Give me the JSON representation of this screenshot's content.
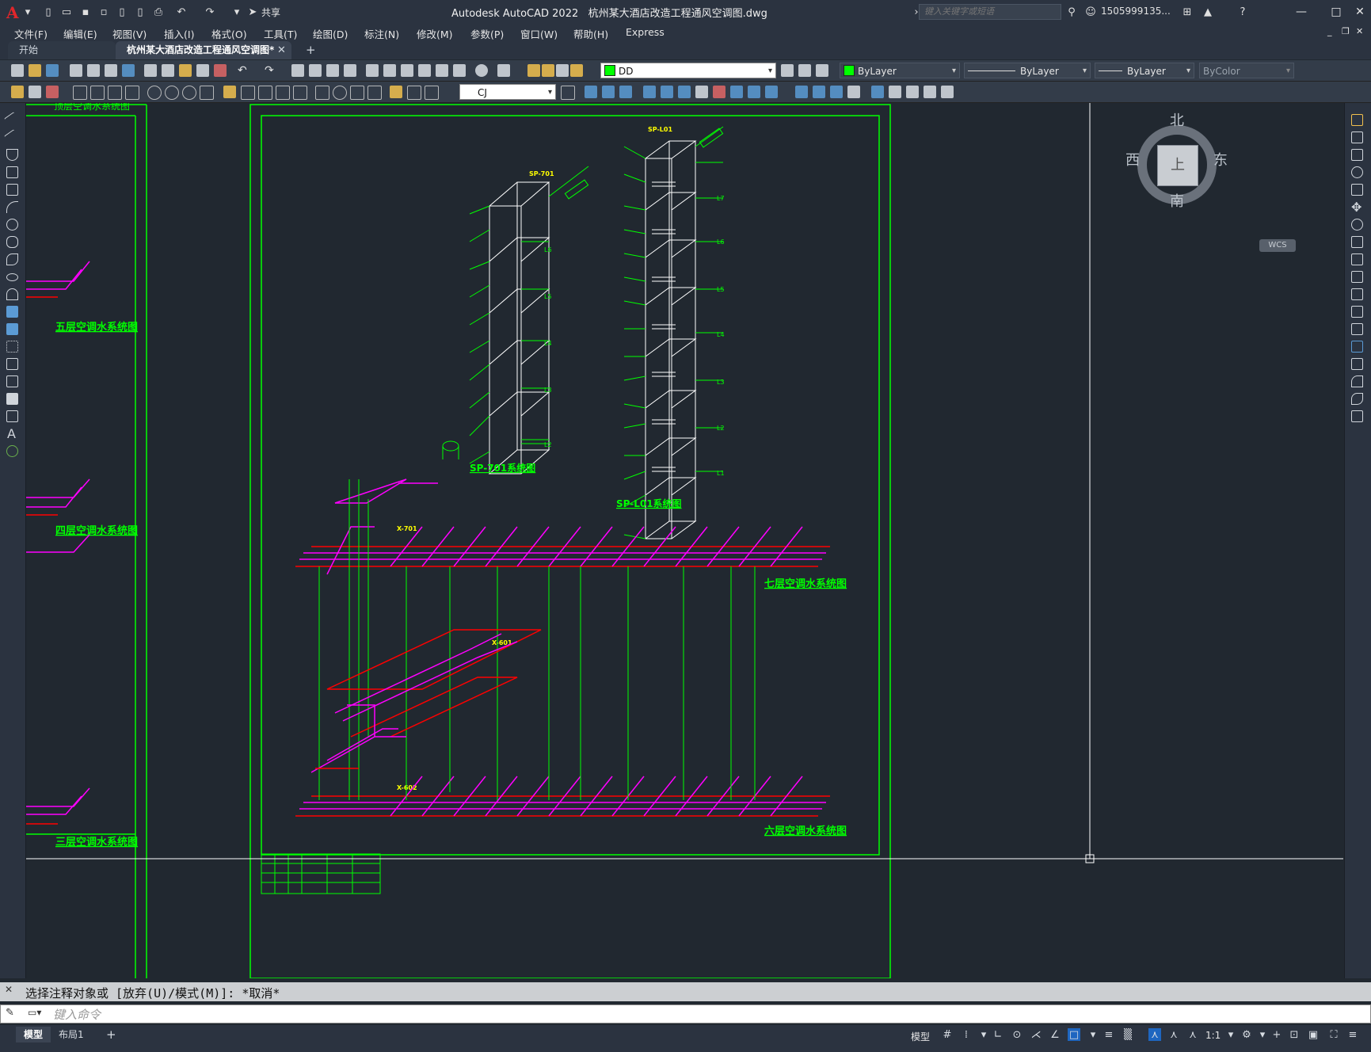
{
  "titlebar": {
    "app_title": "Autodesk AutoCAD 2022",
    "file_name": "杭州某大酒店改造工程通风空调图.dwg",
    "share_label": "共享",
    "search_placeholder": "键入关键字或短语",
    "user_name": "1505999135..."
  },
  "menu": [
    "文件(F)",
    "编辑(E)",
    "视图(V)",
    "插入(I)",
    "格式(O)",
    "工具(T)",
    "绘图(D)",
    "标注(N)",
    "修改(M)",
    "参数(P)",
    "窗口(W)",
    "帮助(H)",
    "Express"
  ],
  "tabs": {
    "start": "开始",
    "drawing": "杭州某大酒店改造工程通风空调图*",
    "close": "✕",
    "plus": "+"
  },
  "toolbar": {
    "layer": "DD",
    "color": "ByLayer",
    "linetype": "ByLayer",
    "lineweight": "ByLayer",
    "plotstyle": "ByColor",
    "text_style": "CJ"
  },
  "drawing": {
    "label_floor5": "五层空调水系统图",
    "label_floor4": "四层空调水系统图",
    "label_floor3": "三层空调水系统图",
    "label_floor7": "七层空调水系统图",
    "label_floor6": "六层空调水系统图",
    "label_sp701": "SP-701系统图",
    "label_spl01": "SP-L01系统图",
    "tag_sp701": "SP-701",
    "tag_spl01": "SP-L01",
    "level_tags_a": [
      "L6",
      "L5",
      "L4",
      "L3",
      "L2"
    ],
    "level_tags_b": [
      "L7",
      "L6",
      "L5",
      "L4",
      "L3",
      "L2",
      "L1"
    ],
    "tag_x701": "X-701",
    "tag_x601": "X-601",
    "tag_x602": "X-602",
    "top_fragment": "顶层空调水系统图"
  },
  "viewcube": {
    "north": "北",
    "south": "南",
    "east": "东",
    "west": "西",
    "top": "上",
    "wcs": "WCS"
  },
  "command": {
    "history": "选择注释对象或 [放弃(U)/模式(M)]: *取消*",
    "placeholder": "键入命令"
  },
  "statusbar": {
    "model_tab": "模型",
    "layout_tab": "布局1",
    "plus": "+",
    "model": "模型",
    "scale": "1:1"
  }
}
